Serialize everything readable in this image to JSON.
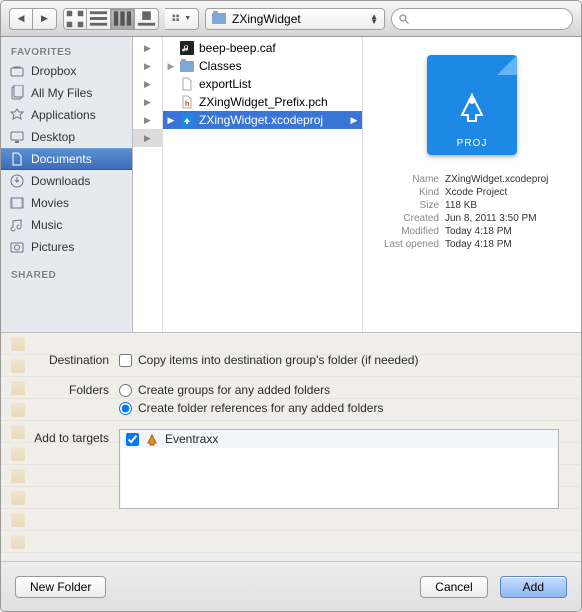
{
  "toolbar": {
    "path": "ZXingWidget"
  },
  "sidebar": {
    "favorites_header": "FAVORITES",
    "shared_header": "SHARED",
    "items": [
      "Dropbox",
      "All My Files",
      "Applications",
      "Desktop",
      "Documents",
      "Downloads",
      "Movies",
      "Music",
      "Pictures"
    ]
  },
  "files": [
    {
      "name": "beep-beep.caf"
    },
    {
      "name": "Classes"
    },
    {
      "name": "exportList"
    },
    {
      "name": "ZXingWidget_Prefix.pch"
    },
    {
      "name": "ZXingWidget.xcodeproj"
    }
  ],
  "preview": {
    "badge": "PROJ",
    "meta": [
      {
        "k": "Name",
        "v": "ZXingWidget.xcodeproj"
      },
      {
        "k": "Kind",
        "v": "Xcode Project"
      },
      {
        "k": "Size",
        "v": "118 KB"
      },
      {
        "k": "Created",
        "v": "Jun 8, 2011 3:50 PM"
      },
      {
        "k": "Modified",
        "v": "Today 4:18 PM"
      },
      {
        "k": "Last opened",
        "v": "Today 4:18 PM"
      }
    ]
  },
  "options": {
    "destination": {
      "label": "Destination",
      "checkbox": "Copy items into destination group's folder (if needed)"
    },
    "folders": {
      "label": "Folders",
      "opt1": "Create groups for any added folders",
      "opt2": "Create folder references for any added folders"
    },
    "targets": {
      "label": "Add to targets",
      "items": [
        "Eventraxx"
      ]
    }
  },
  "footer": {
    "new_folder": "New Folder",
    "cancel": "Cancel",
    "add": "Add"
  }
}
